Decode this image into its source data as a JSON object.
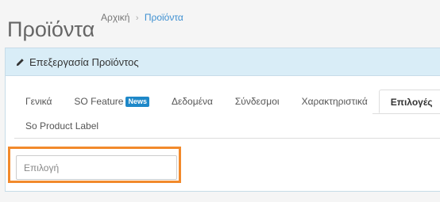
{
  "header": {
    "title": "Προϊόντα",
    "breadcrumb": [
      {
        "label": "Αρχική"
      },
      {
        "separator": "›"
      },
      {
        "label": "Προϊόντα"
      }
    ]
  },
  "panel": {
    "heading_icon": "pencil-icon",
    "heading": "Επεξεργασία Προϊόντος"
  },
  "tabs": [
    {
      "label": "Γενικά"
    },
    {
      "label": "SO Feature",
      "badge": "News"
    },
    {
      "label": "Δεδομένα"
    },
    {
      "label": "Σύνδεσμοι"
    },
    {
      "label": "Χαρακτηριστικά"
    },
    {
      "label": "Επιλογές",
      "active": true
    },
    {
      "label": "So Product Label"
    }
  ],
  "option_field": {
    "placeholder": "Επιλογή",
    "value": ""
  },
  "colors": {
    "panel_heading_bg": "#d9edf7",
    "link_active": "#3d8fd1",
    "badge_bg": "#1e88c8",
    "highlight_border": "#f28a2c"
  }
}
